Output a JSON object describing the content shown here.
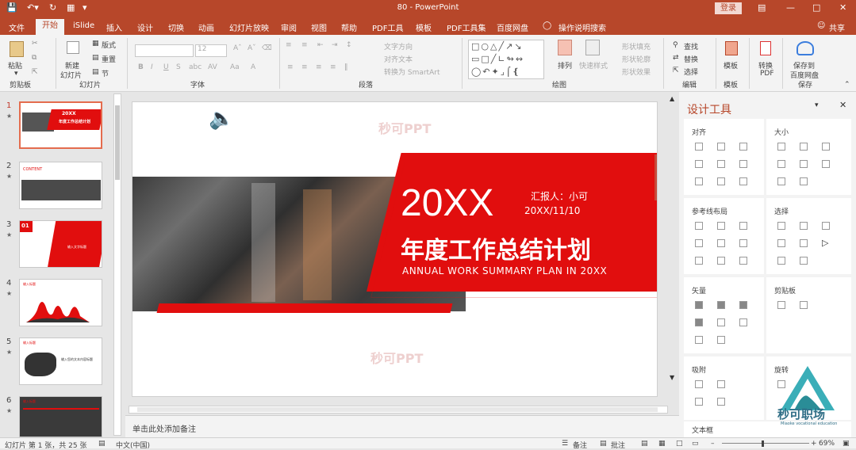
{
  "titlebar": {
    "save_icon": "save-icon",
    "undo_icon": "undo-icon",
    "redo_icon": "redo-icon",
    "title": "80  -  PowerPoint",
    "login": "登录",
    "options_icon": "ribbon-display-options-icon",
    "minimize_icon": "minimize-icon",
    "maximize_icon": "maximize-icon",
    "close_icon": "close-icon"
  },
  "tabs": [
    "文件",
    "开始",
    "iSlide",
    "插入",
    "设计",
    "切换",
    "动画",
    "幻灯片放映",
    "审阅",
    "视图",
    "帮助",
    "PDF工具",
    "模板",
    "PDF工具集",
    "百度网盘",
    "操作说明搜索"
  ],
  "share": "共享",
  "ribbon": {
    "clipboard": {
      "paste": "粘贴",
      "group": "剪贴板"
    },
    "slides": {
      "new": "新建",
      "new2": "幻灯片",
      "layout": "版式",
      "reset": "重置",
      "section": "节",
      "group": "幻灯片"
    },
    "font": {
      "font_name": "",
      "font_size": "12",
      "group": "字体",
      "bold": "B",
      "italic": "I",
      "underline": "U",
      "strike": "S",
      "shadow": "abc",
      "spacing": "AV",
      "case": "Aa",
      "color": "A"
    },
    "paragraph": {
      "text_direction": "文字方向",
      "align_text": "对齐文本",
      "convert_smartart": "转换为 SmartArt",
      "group": "段落"
    },
    "drawing": {
      "arrange": "排列",
      "quick_styles": "快速样式",
      "fill": "形状填充",
      "outline": "形状轮廓",
      "effects": "形状效果",
      "group": "绘图"
    },
    "editing": {
      "find": "查找",
      "replace": "替换",
      "select": "选择",
      "group": "编辑"
    },
    "template": {
      "label": "模板",
      "group": "模板"
    },
    "convert": {
      "label": "转换",
      "label2": "PDF"
    },
    "save": {
      "label": "保存到",
      "label2": "百度网盘",
      "group": "保存"
    }
  },
  "thumbs": [
    {
      "num": "1"
    },
    {
      "num": "2"
    },
    {
      "num": "3"
    },
    {
      "num": "4"
    },
    {
      "num": "5"
    },
    {
      "num": "6"
    }
  ],
  "slide": {
    "watermark1": "秒可PPT",
    "watermark2": "秒可PPT",
    "year": "20XX",
    "reporter": "汇报人：小可",
    "date": "20XX/11/10",
    "title": "年度工作总结计划",
    "subtitle": "ANNUAL WORK SUMMARY PLAN IN 20XX",
    "speaker_icon": "speaker-icon"
  },
  "thumb_texts": {
    "t1_year": "20XX",
    "t1_title": "年度工作总结计划",
    "t2": "CONTENT",
    "t3": "01",
    "t3b": "输入文字标题",
    "t4": "输入标题",
    "t5": "输入标题",
    "t5b": "输入您的文本内容标题",
    "t6": "输入标题"
  },
  "notes": "单击此处添加备注",
  "panel": {
    "title": "设计工具",
    "sections": [
      "对齐",
      "大小",
      "参考线布局",
      "选择",
      "矢量",
      "剪贴板",
      "吸附",
      "旋转",
      "文本框"
    ]
  },
  "logo": {
    "text": "秒可职场",
    "sub": "Miaoke vocational education"
  },
  "status": {
    "slide_info": "幻灯片 第 1 张，共 25 张",
    "lang": "中文(中国)",
    "notes": "备注",
    "comments": "批注",
    "zoom": "69%"
  },
  "colors": {
    "accent": "#b7472a",
    "red": "#e10e0e"
  }
}
